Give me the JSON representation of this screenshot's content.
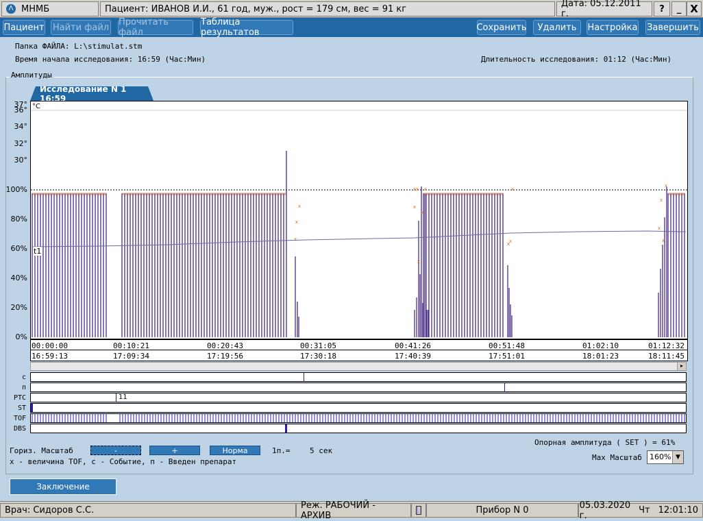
{
  "window": {
    "app_title": "МНМБ",
    "patient": "Пациент:  ИВАНОВ И.И., 61 год, муж., рост = 179 см, вес = 91 кг",
    "date": "Дата:  05.12.2011 г.",
    "help": "?",
    "minimize": "_",
    "close": "X"
  },
  "toolbar": {
    "patient": "Пациент",
    "find_file": "Найти файл",
    "read_file": "Прочитать файл",
    "results_table": "Таблица результатов",
    "save": "Сохранить",
    "delete": "Удалить",
    "settings": "Настройка",
    "finish": "Завершить"
  },
  "info": {
    "folder": "Папка ФАЙЛА:   L:\\stimulat.stm",
    "start_time": "Время начала исследования: 16:59  (Час:Мин)",
    "duration": "Длительность исследования: 01:12  (Час:Мин)"
  },
  "panel": {
    "group_label": "Амплитуды",
    "tab": "Исследование N 1 16:59",
    "unit": "°C",
    "marker": "t1"
  },
  "yaxis": {
    "temp": [
      "37°",
      "36°",
      "34°",
      "32°",
      "30°"
    ],
    "pct": [
      "100%",
      "80%",
      "60%",
      "40%",
      "20%",
      "0%"
    ]
  },
  "time_elapsed": [
    "00:00:00",
    "00:10:21",
    "00:20:43",
    "00:31:05",
    "00:41:26",
    "00:51:48",
    "01:02:10",
    "01:12:32"
  ],
  "time_clock": [
    "16:59:13",
    "17:09:34",
    "17:19:56",
    "17:30:18",
    "17:40:39",
    "17:51:01",
    "18:01:23",
    "18:11:45"
  ],
  "strips": {
    "c": "с",
    "n": "п",
    "ptc": "PTC",
    "st": "ST",
    "tof": "TOF",
    "dbs": "DBS",
    "ptc_value": "11"
  },
  "controls": {
    "hscale": "Гориз. Масштаб",
    "minus": "-",
    "plus": "+",
    "norm": "Норма",
    "per_px": "1п.=",
    "per_px_value": "5 сек",
    "legend": "x - величина TOF, с - Событие, п - Введен препарат",
    "ref_amp": "Опорная амплитуда ( SET ) = 61%",
    "max_scale": "Max Масштаб",
    "max_scale_value": "160%",
    "conclusion": "Заключение"
  },
  "status": {
    "doctor": "Врач: Сидоров С.С.",
    "mode": "Реж. РАБОЧИЙ - АРХИВ",
    "device": "Прибор N 0",
    "date": "05.03.2020 г.",
    "weekday": "Чт",
    "time": "12:01:10"
  },
  "colors": {
    "toolbar": "#1f68a4",
    "bar": "#3b1a7a",
    "tof_marker": "#e07020",
    "trend": "#6a6aa0"
  }
}
